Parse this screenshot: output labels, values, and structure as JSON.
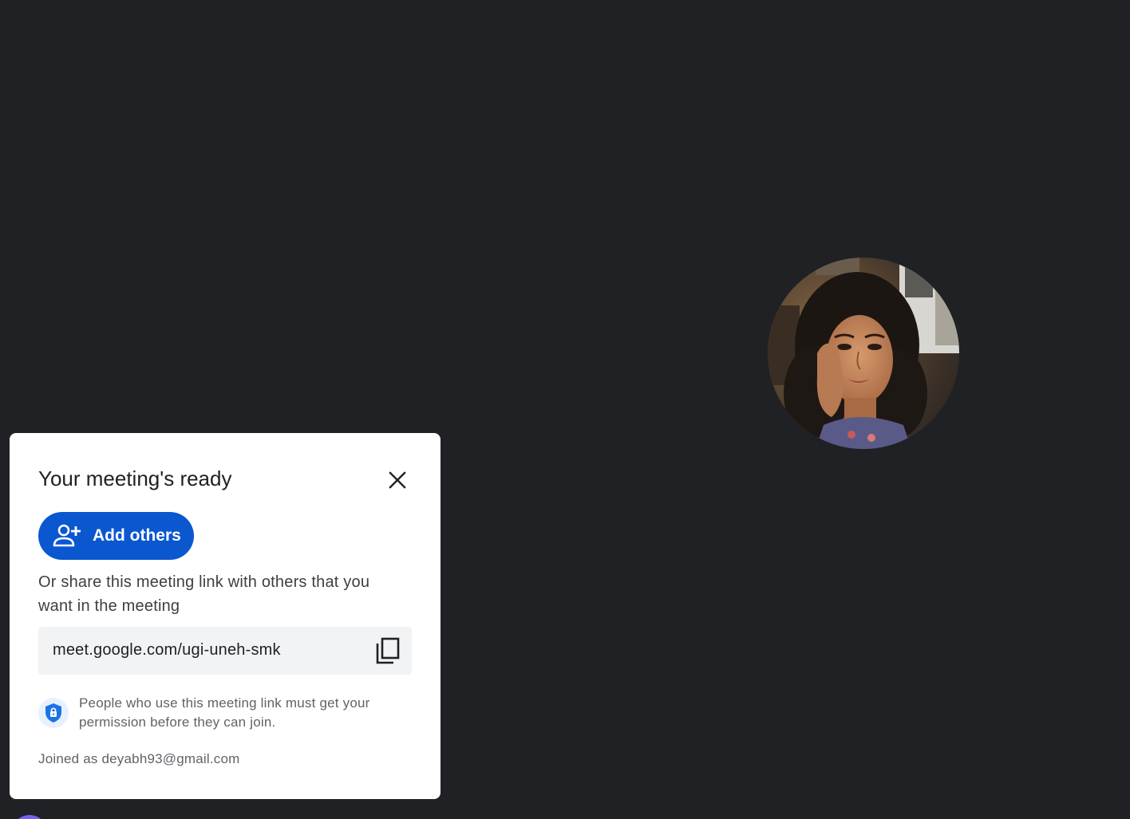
{
  "dialog": {
    "title": "Your meeting's ready",
    "add_others_label": "Add others",
    "share_text": "Or share this meeting link with others that you want in the meeting",
    "meeting_link": "meet.google.com/ugi-uneh-smk",
    "permission_text": "People who use this meeting link must get your permission before they can join.",
    "joined_as": "Joined as deyabh93@gmail.com"
  },
  "icons": {
    "close": "close-icon",
    "add_person": "person-add-icon",
    "copy": "copy-icon",
    "shield": "shield-lock-icon"
  },
  "colors": {
    "background": "#202124",
    "primary_button": "#0b57d0",
    "link_box": "#f1f3f4",
    "shield_bg": "#e8f0fe",
    "shield": "#1a73e8"
  }
}
